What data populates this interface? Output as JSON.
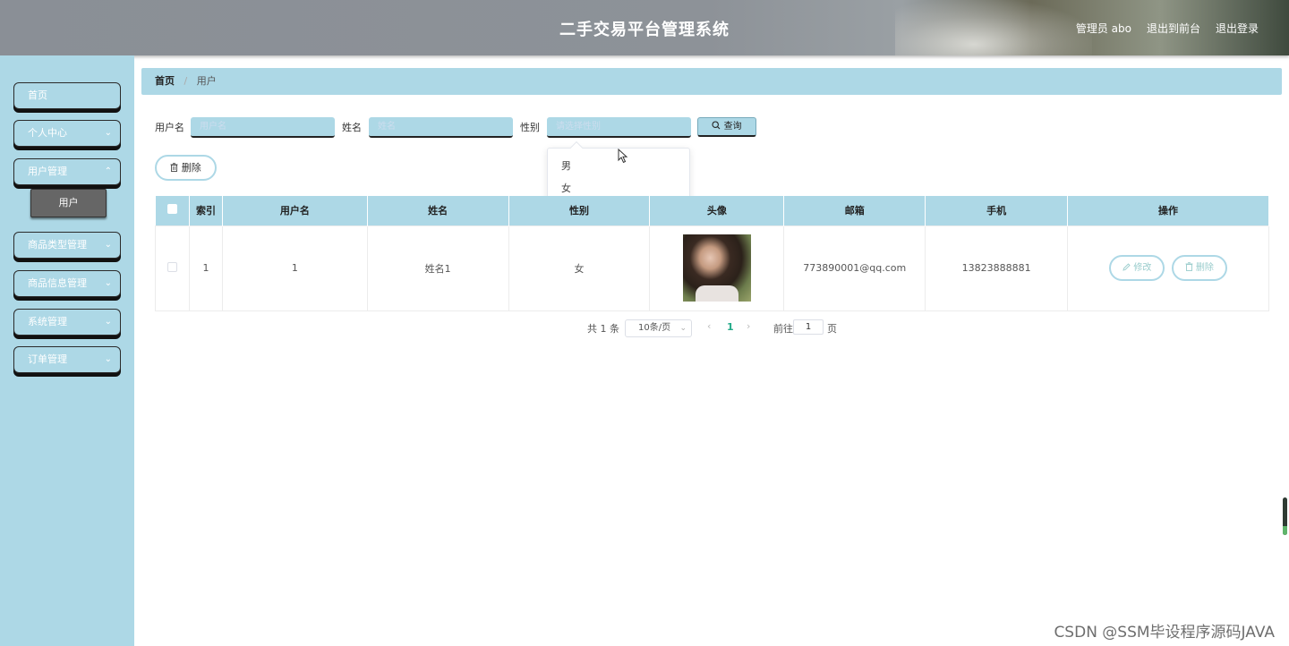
{
  "header": {
    "title": "二手交易平台管理系统",
    "user_label": "管理员 abo",
    "to_front": "退出到前台",
    "logout": "退出登录"
  },
  "sidebar": {
    "items": [
      {
        "label": "首页"
      },
      {
        "label": "个人中心"
      },
      {
        "label": "用户管理"
      },
      {
        "label": "用户"
      },
      {
        "label": "商品类型管理"
      },
      {
        "label": "商品信息管理"
      },
      {
        "label": "系统管理"
      },
      {
        "label": "订单管理"
      }
    ]
  },
  "breadcrumb": {
    "home": "首页",
    "separator": "/",
    "current": "用户"
  },
  "search": {
    "username_label": "用户名",
    "username_placeholder": "用户名",
    "name_label": "姓名",
    "name_placeholder": "姓名",
    "gender_label": "性别",
    "gender_placeholder": "请选择性别",
    "query_button": "查询",
    "gender_options": [
      "男",
      "女"
    ]
  },
  "toolbar": {
    "delete_button": "删除"
  },
  "table": {
    "headers": [
      "索引",
      "用户名",
      "姓名",
      "性别",
      "头像",
      "邮箱",
      "手机",
      "操作"
    ],
    "rows": [
      {
        "index": "1",
        "username": "1",
        "name": "姓名1",
        "gender": "女",
        "email": "773890001@qq.com",
        "phone": "13823888881",
        "edit": "修改",
        "delete": "删除"
      }
    ]
  },
  "pagination": {
    "total": "共 1 条",
    "page_size": "10条/页",
    "prev": "‹",
    "current": "1",
    "next": "›",
    "goto_label": "前往",
    "goto_value": "1",
    "page_suffix": "页"
  },
  "watermark": "CSDN @SSM毕设程序源码JAVA",
  "colors": {
    "accent": "#add8e6",
    "sidebar": "#add8e6",
    "header": "#8d9298"
  }
}
